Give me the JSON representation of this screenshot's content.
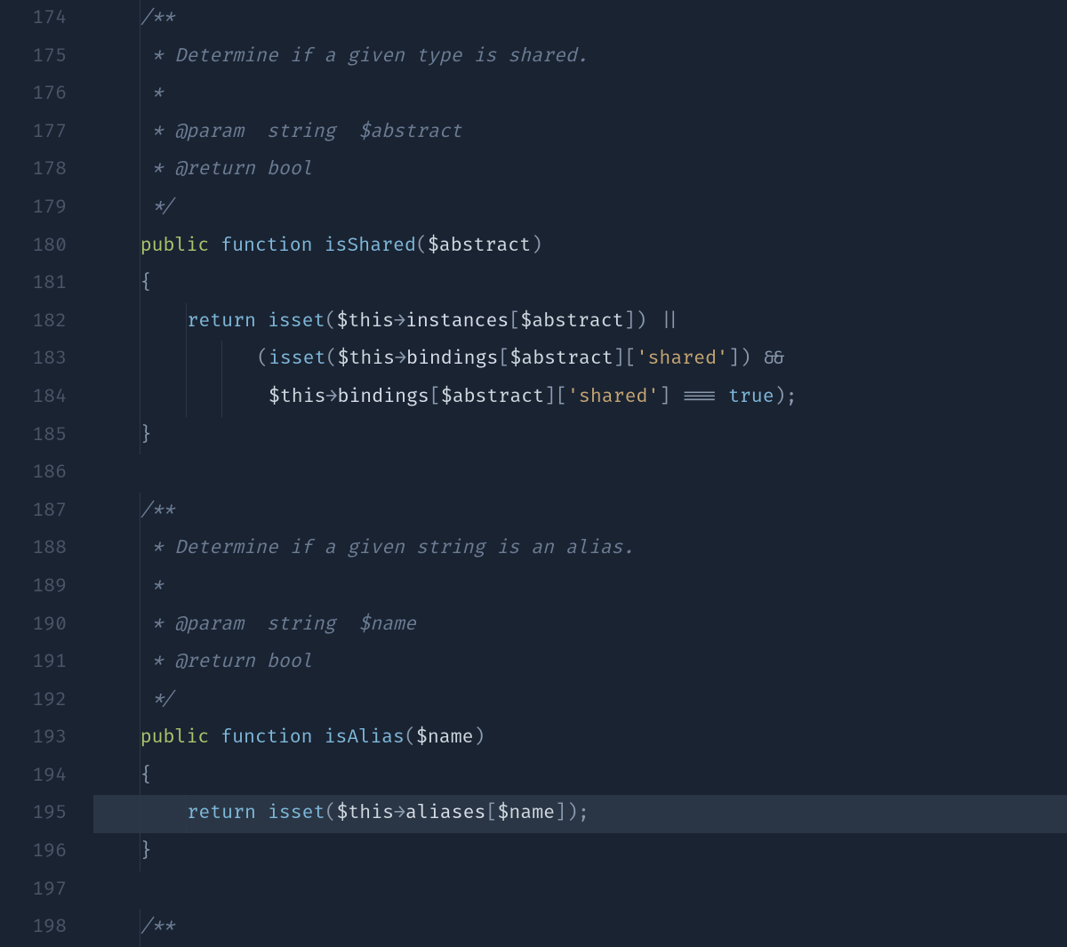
{
  "gutter": {
    "start": 174,
    "end": 198
  },
  "highlighted_line": 195,
  "tokens": {
    "comment_open": "/**",
    "comment_close": " */",
    "star": " *",
    "desc_isShared": " * Determine if a given type is shared.",
    "desc_isAlias": " * Determine if a given string is an alias.",
    "param": "@param",
    "return": "@return",
    "type_string": "  string",
    "type_bool": " bool",
    "var_abstract": "$abstract",
    "var_name": "$name",
    "var_this": "$this",
    "kw_public": "public",
    "kw_function": "function",
    "kw_return": "return",
    "kw_isset": "isset",
    "kw_true": "true",
    "fn_isShared": "isShared",
    "fn_isAlias": "isAlias",
    "prop_instances": "instances",
    "prop_bindings": "bindings",
    "prop_aliases": "aliases",
    "str_shared": "'shared'",
    "op_arrow": "→",
    "op_or": "||",
    "op_and": "&&",
    "op_identical": "===",
    "brace_open": "{",
    "brace_close": "}",
    "paren_open": "(",
    "paren_close": ")",
    "bracket_open": "[",
    "bracket_close": "]",
    "semicolon": ";"
  },
  "indent": "    "
}
